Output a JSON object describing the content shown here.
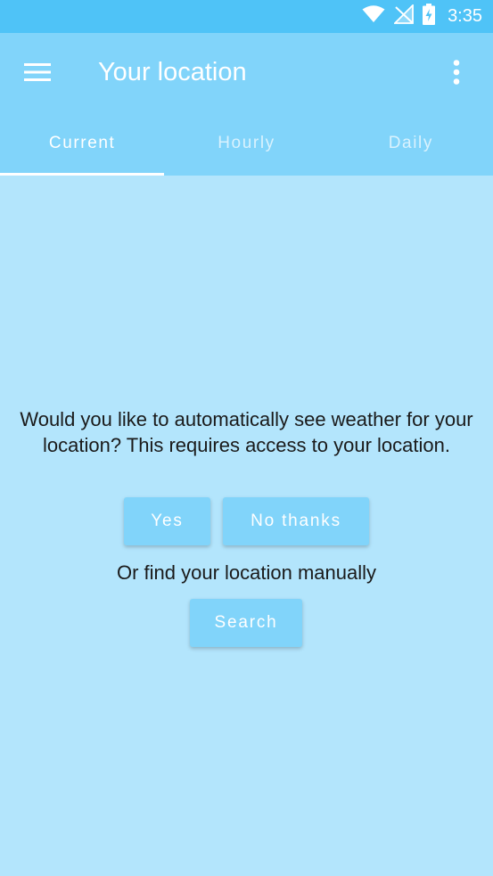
{
  "status_bar": {
    "time": "3:35",
    "icons": [
      "wifi-icon",
      "no-signal-icon",
      "battery-charging-icon"
    ]
  },
  "app_bar": {
    "title": "Your location",
    "menu_icon": "menu-icon",
    "overflow_icon": "more-vert-icon"
  },
  "tabs": [
    {
      "label": "Current",
      "active": true
    },
    {
      "label": "Hourly",
      "active": false
    },
    {
      "label": "Daily",
      "active": false
    }
  ],
  "content": {
    "prompt": "Would you like to automatically see weather for your location? This requires access to your location.",
    "yes_label": "Yes",
    "no_label": "No thanks",
    "manual_text": "Or find your location manually",
    "search_label": "Search"
  },
  "colors": {
    "status_bar": "#4fc3f7",
    "app_bar": "#81d4fa",
    "background": "#b3e5fc",
    "button": "#81d4fa",
    "text": "#1a1a1a",
    "on_primary": "#ffffff"
  }
}
